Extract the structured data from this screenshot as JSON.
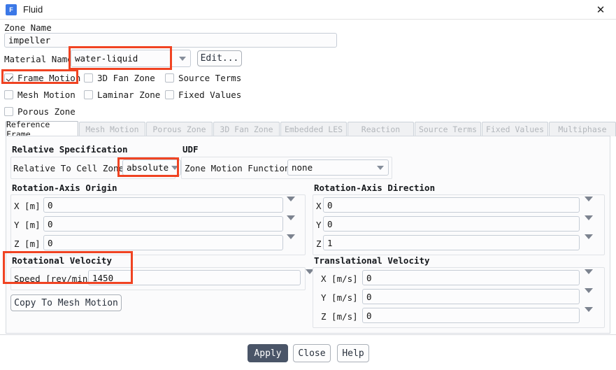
{
  "window": {
    "title": "Fluid",
    "icon": "fluent-app-icon",
    "icon_letter": "F",
    "close_label": "✕"
  },
  "form": {
    "zone_name_label": "Zone Name",
    "zone_name_value": "impeller",
    "material_name_label": "Material Name",
    "material_name_value": "water-liquid",
    "edit_button": "Edit...",
    "checkboxes": [
      {
        "label": "Frame Motion",
        "checked": true
      },
      {
        "label": "3D Fan Zone",
        "checked": false
      },
      {
        "label": "Source Terms",
        "checked": false
      },
      {
        "label": "Mesh Motion",
        "checked": false
      },
      {
        "label": "Laminar Zone",
        "checked": false
      },
      {
        "label": "Fixed Values",
        "checked": false
      },
      {
        "label": "Porous Zone",
        "checked": false
      }
    ]
  },
  "tabs": [
    {
      "label": "Reference Frame",
      "active": true
    },
    {
      "label": "Mesh Motion",
      "active": false
    },
    {
      "label": "Porous Zone",
      "active": false
    },
    {
      "label": "3D Fan Zone",
      "active": false
    },
    {
      "label": "Embedded LES",
      "active": false
    },
    {
      "label": "Reaction",
      "active": false
    },
    {
      "label": "Source Terms",
      "active": false
    },
    {
      "label": "Fixed Values",
      "active": false
    },
    {
      "label": "Multiphase",
      "active": false
    }
  ],
  "reference_frame": {
    "relative_specification": {
      "title": "Relative Specification",
      "field_label": "Relative To Cell Zone",
      "value": "absolute"
    },
    "udf": {
      "title": "UDF",
      "field_label": "Zone Motion Function",
      "value": "none"
    },
    "rotation_axis_origin": {
      "title": "Rotation-Axis Origin",
      "rows": [
        {
          "label": "X [m]",
          "value": "0"
        },
        {
          "label": "Y [m]",
          "value": "0"
        },
        {
          "label": "Z [m]",
          "value": "0"
        }
      ]
    },
    "rotation_axis_direction": {
      "title": "Rotation-Axis Direction",
      "rows": [
        {
          "label": "X",
          "value": "0"
        },
        {
          "label": "Y",
          "value": "0"
        },
        {
          "label": "Z",
          "value": "1"
        }
      ]
    },
    "rotational_velocity": {
      "title": "Rotational Velocity",
      "speed_label": "Speed [rev/min]",
      "speed_value": "1450",
      "copy_button": "Copy To Mesh Motion"
    },
    "translational_velocity": {
      "title": "Translational Velocity",
      "rows": [
        {
          "label": "X [m/s]",
          "value": "0"
        },
        {
          "label": "Y [m/s]",
          "value": "0"
        },
        {
          "label": "Z [m/s]",
          "value": "0"
        }
      ]
    }
  },
  "footer": {
    "apply": "Apply",
    "close": "Close",
    "help": "Help"
  },
  "annotations": {
    "accent_color": "#f04322",
    "highlights": [
      "material-name-combo",
      "frame-motion-checkbox",
      "relative-to-cell-zone-combo",
      "rotational-velocity-group"
    ]
  }
}
